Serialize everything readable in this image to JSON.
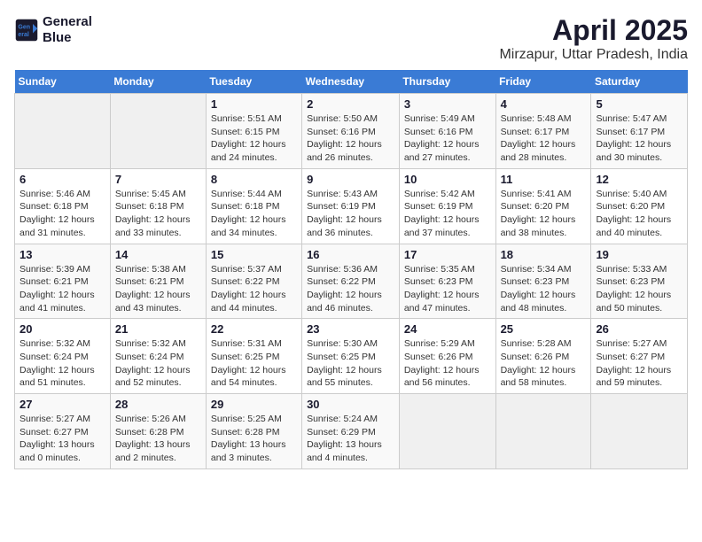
{
  "logo": {
    "line1": "General",
    "line2": "Blue"
  },
  "title": "April 2025",
  "subtitle": "Mirzapur, Uttar Pradesh, India",
  "days_header": [
    "Sunday",
    "Monday",
    "Tuesday",
    "Wednesday",
    "Thursday",
    "Friday",
    "Saturday"
  ],
  "weeks": [
    [
      {
        "day": "",
        "info": ""
      },
      {
        "day": "",
        "info": ""
      },
      {
        "day": "1",
        "info": "Sunrise: 5:51 AM\nSunset: 6:15 PM\nDaylight: 12 hours\nand 24 minutes."
      },
      {
        "day": "2",
        "info": "Sunrise: 5:50 AM\nSunset: 6:16 PM\nDaylight: 12 hours\nand 26 minutes."
      },
      {
        "day": "3",
        "info": "Sunrise: 5:49 AM\nSunset: 6:16 PM\nDaylight: 12 hours\nand 27 minutes."
      },
      {
        "day": "4",
        "info": "Sunrise: 5:48 AM\nSunset: 6:17 PM\nDaylight: 12 hours\nand 28 minutes."
      },
      {
        "day": "5",
        "info": "Sunrise: 5:47 AM\nSunset: 6:17 PM\nDaylight: 12 hours\nand 30 minutes."
      }
    ],
    [
      {
        "day": "6",
        "info": "Sunrise: 5:46 AM\nSunset: 6:18 PM\nDaylight: 12 hours\nand 31 minutes."
      },
      {
        "day": "7",
        "info": "Sunrise: 5:45 AM\nSunset: 6:18 PM\nDaylight: 12 hours\nand 33 minutes."
      },
      {
        "day": "8",
        "info": "Sunrise: 5:44 AM\nSunset: 6:18 PM\nDaylight: 12 hours\nand 34 minutes."
      },
      {
        "day": "9",
        "info": "Sunrise: 5:43 AM\nSunset: 6:19 PM\nDaylight: 12 hours\nand 36 minutes."
      },
      {
        "day": "10",
        "info": "Sunrise: 5:42 AM\nSunset: 6:19 PM\nDaylight: 12 hours\nand 37 minutes."
      },
      {
        "day": "11",
        "info": "Sunrise: 5:41 AM\nSunset: 6:20 PM\nDaylight: 12 hours\nand 38 minutes."
      },
      {
        "day": "12",
        "info": "Sunrise: 5:40 AM\nSunset: 6:20 PM\nDaylight: 12 hours\nand 40 minutes."
      }
    ],
    [
      {
        "day": "13",
        "info": "Sunrise: 5:39 AM\nSunset: 6:21 PM\nDaylight: 12 hours\nand 41 minutes."
      },
      {
        "day": "14",
        "info": "Sunrise: 5:38 AM\nSunset: 6:21 PM\nDaylight: 12 hours\nand 43 minutes."
      },
      {
        "day": "15",
        "info": "Sunrise: 5:37 AM\nSunset: 6:22 PM\nDaylight: 12 hours\nand 44 minutes."
      },
      {
        "day": "16",
        "info": "Sunrise: 5:36 AM\nSunset: 6:22 PM\nDaylight: 12 hours\nand 46 minutes."
      },
      {
        "day": "17",
        "info": "Sunrise: 5:35 AM\nSunset: 6:23 PM\nDaylight: 12 hours\nand 47 minutes."
      },
      {
        "day": "18",
        "info": "Sunrise: 5:34 AM\nSunset: 6:23 PM\nDaylight: 12 hours\nand 48 minutes."
      },
      {
        "day": "19",
        "info": "Sunrise: 5:33 AM\nSunset: 6:23 PM\nDaylight: 12 hours\nand 50 minutes."
      }
    ],
    [
      {
        "day": "20",
        "info": "Sunrise: 5:32 AM\nSunset: 6:24 PM\nDaylight: 12 hours\nand 51 minutes."
      },
      {
        "day": "21",
        "info": "Sunrise: 5:32 AM\nSunset: 6:24 PM\nDaylight: 12 hours\nand 52 minutes."
      },
      {
        "day": "22",
        "info": "Sunrise: 5:31 AM\nSunset: 6:25 PM\nDaylight: 12 hours\nand 54 minutes."
      },
      {
        "day": "23",
        "info": "Sunrise: 5:30 AM\nSunset: 6:25 PM\nDaylight: 12 hours\nand 55 minutes."
      },
      {
        "day": "24",
        "info": "Sunrise: 5:29 AM\nSunset: 6:26 PM\nDaylight: 12 hours\nand 56 minutes."
      },
      {
        "day": "25",
        "info": "Sunrise: 5:28 AM\nSunset: 6:26 PM\nDaylight: 12 hours\nand 58 minutes."
      },
      {
        "day": "26",
        "info": "Sunrise: 5:27 AM\nSunset: 6:27 PM\nDaylight: 12 hours\nand 59 minutes."
      }
    ],
    [
      {
        "day": "27",
        "info": "Sunrise: 5:27 AM\nSunset: 6:27 PM\nDaylight: 13 hours\nand 0 minutes."
      },
      {
        "day": "28",
        "info": "Sunrise: 5:26 AM\nSunset: 6:28 PM\nDaylight: 13 hours\nand 2 minutes."
      },
      {
        "day": "29",
        "info": "Sunrise: 5:25 AM\nSunset: 6:28 PM\nDaylight: 13 hours\nand 3 minutes."
      },
      {
        "day": "30",
        "info": "Sunrise: 5:24 AM\nSunset: 6:29 PM\nDaylight: 13 hours\nand 4 minutes."
      },
      {
        "day": "",
        "info": ""
      },
      {
        "day": "",
        "info": ""
      },
      {
        "day": "",
        "info": ""
      }
    ]
  ]
}
